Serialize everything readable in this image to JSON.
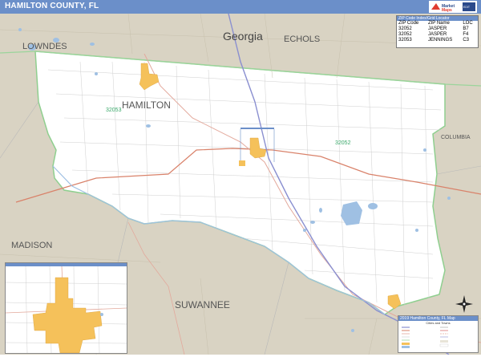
{
  "title": "HAMILTON COUNTY, FL",
  "logo_text": "Market Maps",
  "logo_sub": "EDITABLE",
  "labels": {
    "state": "Georgia",
    "county_main": "HAMILTON",
    "lowndes": "LOWNDES",
    "echols": "ECHOLS",
    "columbia": "COLUMBIA",
    "madison": "MADISON",
    "suwannee": "SUWANNEE",
    "zip_west": "32053",
    "zip_east": "32052"
  },
  "zip_index": {
    "header": "ZIP Code Index/Grid Locator",
    "columns": [
      "ZIP Code",
      "ZIP Name",
      "LOC"
    ],
    "rows": [
      [
        "32052",
        "JASPER",
        "B7"
      ],
      [
        "32052",
        "JASPER",
        "F4"
      ],
      [
        "32053",
        "JENNINGS",
        "C3"
      ]
    ]
  },
  "legend": {
    "title": "2019 Hamilton County, FL Map",
    "subtitle": "Cities and Towns"
  },
  "colors": {
    "header": "#6b8fc9",
    "outside": "#d9d3c3",
    "county": "#ffffff",
    "city": "#f5c15a",
    "water": "#9fc0e3",
    "road_major": "#d9826a",
    "road_interstate": "#8a8fd0",
    "boundary": "#9bd49b"
  }
}
